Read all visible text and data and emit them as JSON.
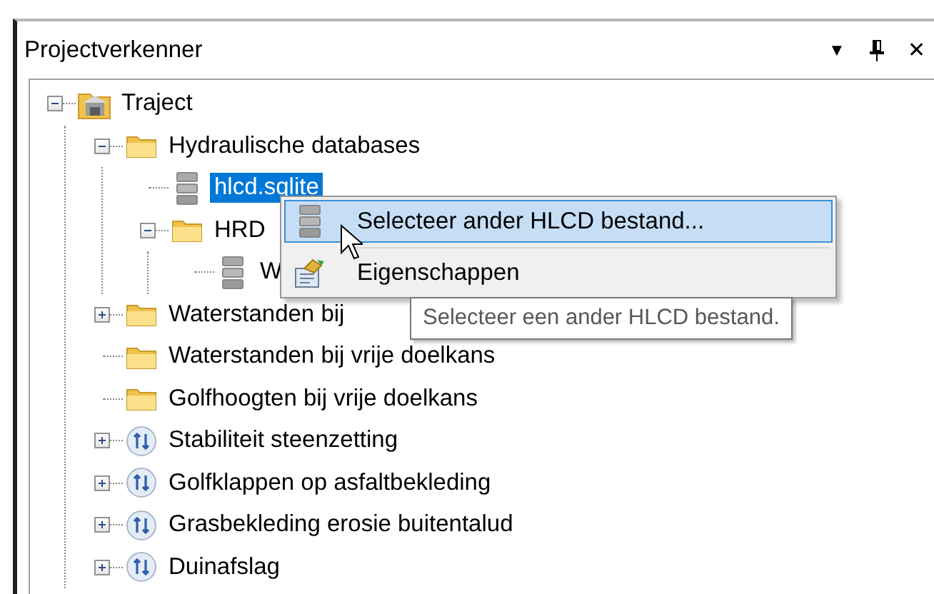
{
  "panel": {
    "title": "Projectverkenner",
    "buttons": [
      {
        "kind": "dropdown",
        "glyph": "▼"
      },
      {
        "kind": "pin"
      },
      {
        "kind": "close",
        "glyph": "✕"
      }
    ]
  },
  "tree": [
    {
      "label": "Traject",
      "kind": "project",
      "expandable": true,
      "expanded": true,
      "selected": false,
      "children": [
        {
          "label": "Hydraulische databases",
          "kind": "folder",
          "expandable": true,
          "expanded": true,
          "selected": false,
          "children": [
            {
              "label": "hlcd.sqlite",
              "kind": "database",
              "expandable": false,
              "selected": true
            },
            {
              "label": "HRD",
              "kind": "folder",
              "expandable": true,
              "expanded": true,
              "selected": false,
              "children": [
                {
                  "label": "W",
                  "kind": "database",
                  "expandable": false,
                  "selected": false
                }
              ]
            }
          ]
        },
        {
          "label": "Waterstanden bij",
          "kind": "folder",
          "expandable": true,
          "expanded": false,
          "selected": false
        },
        {
          "label": "Waterstanden bij vrije doelkans",
          "kind": "folder",
          "expandable": false,
          "selected": false
        },
        {
          "label": "Golfhoogten bij vrije doelkans",
          "kind": "folder",
          "expandable": false,
          "selected": false
        },
        {
          "label": "Stabiliteit steenzetting",
          "kind": "mechanism",
          "expandable": true,
          "expanded": false,
          "selected": false
        },
        {
          "label": "Golfklappen op asfaltbekleding",
          "kind": "mechanism",
          "expandable": true,
          "expanded": false,
          "selected": false
        },
        {
          "label": "Grasbekleding erosie buitentalud",
          "kind": "mechanism",
          "expandable": true,
          "expanded": false,
          "selected": false
        },
        {
          "label": "Duinafslag",
          "kind": "mechanism",
          "expandable": true,
          "expanded": false,
          "selected": false
        }
      ]
    }
  ],
  "context_menu": [
    {
      "label": "Selecteer ander HLCD bestand...",
      "kind": "database",
      "selected": true
    },
    {
      "label": "Eigenschappen",
      "kind": "properties",
      "selected": false
    }
  ],
  "tooltip": "Selecteer een ander HLCD bestand."
}
